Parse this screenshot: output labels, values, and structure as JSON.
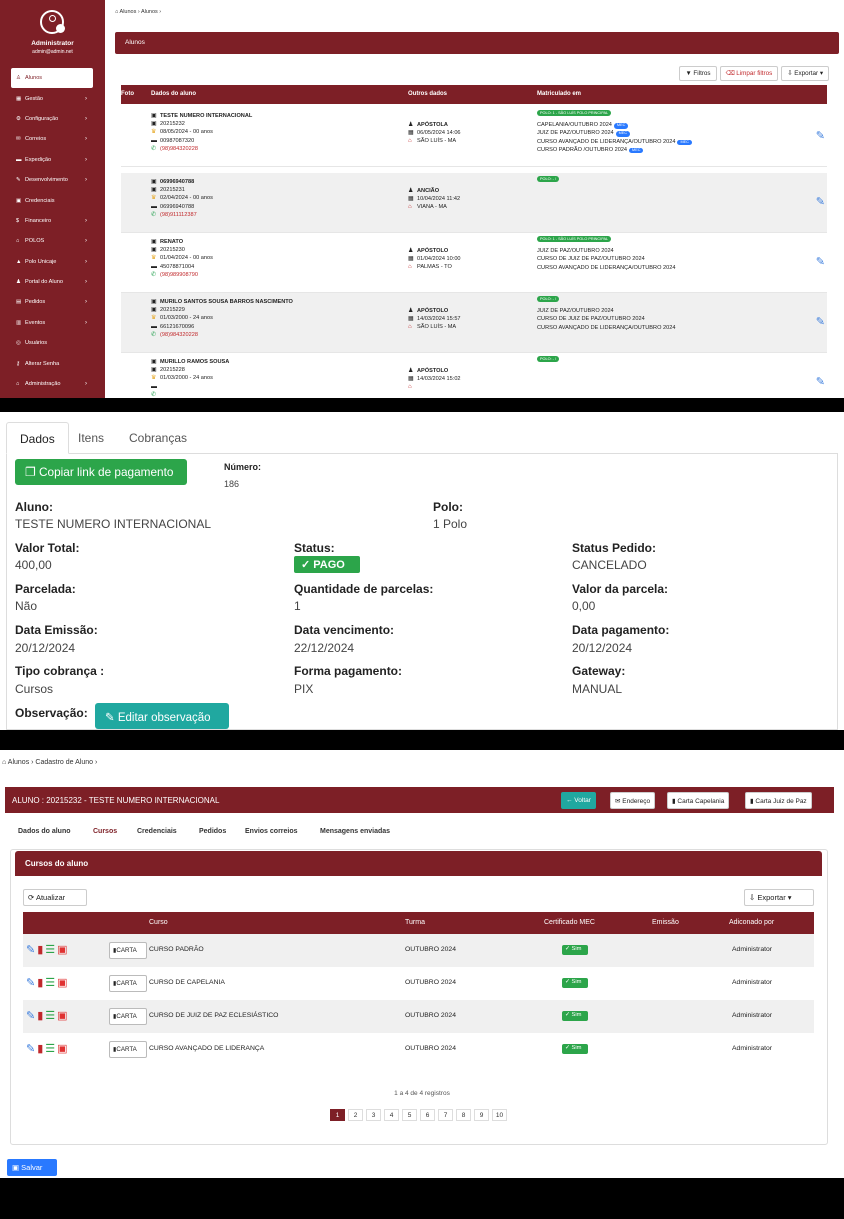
{
  "p1": {
    "user": {
      "name": "Administrator",
      "email": "admin@admin.net"
    },
    "menu": [
      {
        "icon": "♙",
        "label": "Alunos",
        "caret": ""
      },
      {
        "icon": "▦",
        "label": "Gestão",
        "caret": "›"
      },
      {
        "icon": "⚙",
        "label": "Configuração",
        "caret": "›"
      },
      {
        "icon": "✉",
        "label": "Correios",
        "caret": "›"
      },
      {
        "icon": "▬",
        "label": "Expedição",
        "caret": "›"
      },
      {
        "icon": "✎",
        "label": "Desenvolvimento",
        "caret": "›"
      },
      {
        "icon": "▣",
        "label": "Credenciais",
        "caret": ""
      },
      {
        "icon": "$",
        "label": "Financeiro",
        "caret": "›"
      },
      {
        "icon": "⌂",
        "label": "POLOS",
        "caret": "›"
      },
      {
        "icon": "▲",
        "label": "Polo Unicaje",
        "caret": "›"
      },
      {
        "icon": "♟",
        "label": "Portal do Aluno",
        "caret": "›"
      },
      {
        "icon": "▤",
        "label": "Pedidos",
        "caret": "›"
      },
      {
        "icon": "▥",
        "label": "Eventos",
        "caret": "›"
      },
      {
        "icon": "◎",
        "label": "Usuários",
        "caret": ""
      },
      {
        "icon": "⚷",
        "label": "Alterar Senha",
        "caret": ""
      },
      {
        "icon": "⌂",
        "label": "Administração",
        "caret": "›"
      }
    ],
    "breadcrumb": "⌂ Alunos  ›  Alunos  ›",
    "header": "Alunos",
    "toolbar": {
      "filters": "▼ Filtros",
      "clear": "⌫ Limpar filtros",
      "export": "⇩ Exportar ▾"
    },
    "columns": {
      "foto": "Foto",
      "dados": "Dados do aluno",
      "outros": "Outros dados",
      "matric": "Matriculado em"
    },
    "rows": [
      {
        "name": "TESTE NUMERO INTERNACIONAL",
        "id": "20215232",
        "birth": "08/05/2024 - 00 anos",
        "doc": "00987087320",
        "phone": "(98)984320228",
        "role": "APÓSTOLA",
        "date": "06/05/2024 14:06",
        "city": "SÃO LUÍS - MA",
        "tag": "POLO: 1 - SÃO LUÍS POLO PRINCIPAL",
        "courses": [
          {
            "t": "CAPELANIA/OUTUBRO 2024",
            "mec": "MEC"
          },
          {
            "t": "JUIZ DE PAZ/OUTUBRO 2024",
            "mec": "MEC"
          },
          {
            "t": "CURSO AVANÇADO DE LIDERANÇA/OUTUBRO 2024",
            "mec": "MEC"
          },
          {
            "t": "CURSO PADRÃO /OUTUBRO 2024",
            "mec": "MEC"
          }
        ]
      },
      {
        "name": "06996940788",
        "id": "20215231",
        "birth": "02/04/2024 - 00 anos",
        "doc": "06996940788",
        "phone": "(98)911112387",
        "role": "ANCIÃO",
        "date": "10/04/2024 11:42",
        "city": "VIANA - MA",
        "tag": "POLO: - /",
        "courses": []
      },
      {
        "name": "RENATO",
        "id": "20215230",
        "birth": "01/04/2024 - 00 anos",
        "doc": "45078871004",
        "phone": "(98)989908790",
        "role": "APÓSTOLO",
        "date": "01/04/2024 10:00",
        "city": "PALMAS - TO",
        "tag": "POLO: 1 - SÃO LUÍS POLO PRINCIPAL",
        "courses": [
          {
            "t": "JUIZ DE PAZ/OUTUBRO 2024",
            "mec": ""
          },
          {
            "t": "CURSO DE JUIZ DE PAZ/OUTUBRO 2024",
            "mec": ""
          },
          {
            "t": "CURSO AVANÇADO DE LIDERANÇA/OUTUBRO 2024",
            "mec": ""
          }
        ]
      },
      {
        "name": "MURILO SANTOS SOUSA BARROS NASCIMENTO",
        "id": "20215229",
        "birth": "01/03/2000 - 24 anos",
        "doc": "66121670096",
        "phone": "(98)984320228",
        "role": "APÓSTOLO",
        "date": "14/03/2024 15:57",
        "city": "SÃO LUÍS - MA",
        "tag": "POLO: - /",
        "courses": [
          {
            "t": "JUIZ DE PAZ/OUTUBRO 2024",
            "mec": ""
          },
          {
            "t": "CURSO DE JUIZ DE PAZ/OUTUBRO 2024",
            "mec": ""
          },
          {
            "t": "CURSO AVANÇADO DE LIDERANÇA/OUTUBRO 2024",
            "mec": ""
          }
        ]
      },
      {
        "name": "MURILLO RAMOS SOUSA",
        "id": "20215228",
        "birth": "01/03/2000 - 24 anos",
        "doc": "",
        "phone": "",
        "role": "APÓSTOLO",
        "date": "14/03/2024 15:02",
        "city": "",
        "tag": "POLO: - /",
        "courses": []
      }
    ]
  },
  "p2": {
    "tabs": [
      "Dados",
      "Itens",
      "Cobranças"
    ],
    "copy_label": "Copiar link de pagamento",
    "numero_label": "Número:",
    "numero": "186",
    "aluno_label": "Aluno:",
    "aluno": "TESTE NUMERO INTERNACIONAL",
    "polo_label": "Polo:",
    "polo": "1  Polo",
    "valor_label": "Valor Total:",
    "valor": "400,00",
    "status_label": "Status:",
    "status": "✓  PAGO",
    "status_ped_label": "Status Pedido:",
    "status_ped": "CANCELADO",
    "parcelada_label": "Parcelada:",
    "parcelada": "Não",
    "qtd_label": "Quantidade de parcelas:",
    "qtd": "1",
    "vparc_label": "Valor da parcela:",
    "vparc": "0,00",
    "emissao_label": "Data Emissão:",
    "emissao": "20/12/2024",
    "venc_label": "Data vencimento:",
    "venc": "22/12/2024",
    "pag_label": "Data pagamento:",
    "pag": "20/12/2024",
    "tipo_label": "Tipo cobrança :",
    "tipo": "Cursos",
    "forma_label": "Forma pagamento:",
    "forma": "PIX",
    "gateway_label": "Gateway:",
    "gateway": "MANUAL",
    "obs_label": "Observação:",
    "obs_btn": "Editar observação"
  },
  "p3": {
    "breadcrumb": "⌂ Alunos  ›  Cadastro de Aluno  ›",
    "title": "ALUNO : 20215232 - TESTE NUMERO INTERNACIONAL",
    "buttons": {
      "voltar": "← Voltar",
      "endereco": "✉ Endereço",
      "capelania": "▮ Carta Capelania",
      "juiz": "▮ Carta Juiz de Paz"
    },
    "tabs": [
      "Dados do aluno",
      "Cursos",
      "Credenciais",
      "Pedidos",
      "Envios correios",
      "Mensagens enviadas"
    ],
    "card_title": "Cursos do aluno",
    "atualizar": "⟳ Atualizar",
    "exportar": "⇩ Exportar ▾",
    "columns": {
      "curso": "Curso",
      "turma": "Turma",
      "cert": "Certificado MEC",
      "emissao": "Emissão",
      "adic": "Adiconado por"
    },
    "rows": [
      {
        "curso": "CURSO PADRÃO",
        "turma": "OUTUBRO 2024",
        "cert": "✓ Sim",
        "por": "Administrator"
      },
      {
        "curso": "CURSO DE CAPELANIA",
        "turma": "OUTUBRO 2024",
        "cert": "✓ Sim",
        "por": "Administrator"
      },
      {
        "curso": "CURSO DE JUIZ DE PAZ ECLESIÁSTICO",
        "turma": "OUTUBRO 2024",
        "cert": "✓ Sim",
        "por": "Administrator"
      },
      {
        "curso": "CURSO AVANÇADO DE LIDERANÇA",
        "turma": "OUTUBRO 2024",
        "cert": "✓ Sim",
        "por": "Administrator"
      }
    ],
    "carta": "▮CARTA",
    "registros": "1 a 4 de 4 registros",
    "pages": [
      "1",
      "2",
      "3",
      "4",
      "5",
      "6",
      "7",
      "8",
      "9",
      "10"
    ],
    "salvar": "▣ Salvar"
  }
}
